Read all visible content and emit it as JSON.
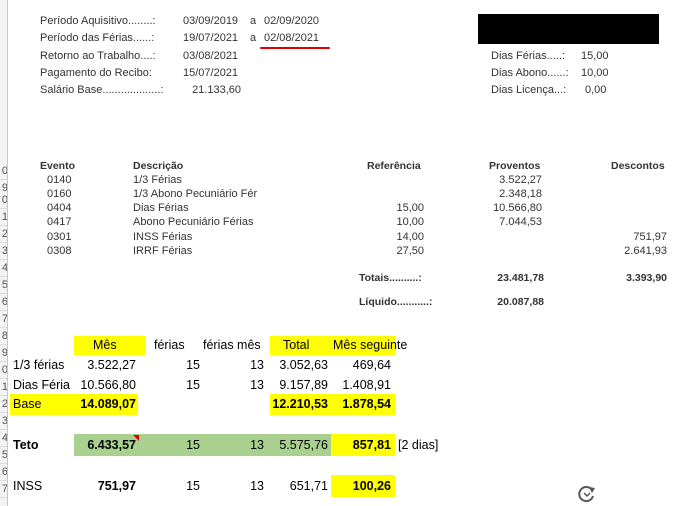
{
  "row_numbers": [
    "",
    "",
    "",
    "",
    "",
    "",
    "",
    "",
    "",
    "",
    "",
    "0",
    "1",
    "2",
    "3",
    "4",
    "5",
    "6",
    "7",
    "8",
    "9",
    "0",
    "1",
    "2",
    "3",
    "4",
    "5",
    "6",
    "7",
    "8",
    "9"
  ],
  "header": {
    "periodo_aquisitivo": {
      "label": "Período Aquisitivo........:",
      "from": "03/09/2019",
      "sep": "a",
      "to": "02/09/2020"
    },
    "periodo_ferias": {
      "label": "Período das Férias......:",
      "from": "19/07/2021",
      "sep": "a",
      "to": "02/08/2021"
    },
    "retorno": {
      "label": "Retorno ao Trabalho....:",
      "value": "03/08/2021"
    },
    "pagamento": {
      "label": "Pagamento do Recibo:",
      "value": "15/07/2021"
    },
    "salario": {
      "label": "Salário Base...................:",
      "value": "21.133,60"
    },
    "dias_ferias": {
      "label": "Dias Férias.....:",
      "value": "15,00"
    },
    "dias_abono": {
      "label": "Dias Abono......:",
      "value": "10,00"
    },
    "dias_licenca": {
      "label": "Dias Licença...:",
      "value": "0,00"
    }
  },
  "table": {
    "headers": {
      "evento": "Evento",
      "descricao": "Descrição",
      "referencia": "Referência",
      "proventos": "Proventos",
      "descontos": "Descontos"
    },
    "rows": [
      {
        "evento": "0140",
        "descricao": "1/3 Férias",
        "referencia": "",
        "proventos": "3.522,27",
        "descontos": ""
      },
      {
        "evento": "0160",
        "descricao": "1/3 Abono Pecuniário Fér",
        "referencia": "",
        "proventos": "2.348,18",
        "descontos": ""
      },
      {
        "evento": "0404",
        "descricao": "Dias Férias",
        "referencia": "15,00",
        "proventos": "10.566,80",
        "descontos": ""
      },
      {
        "evento": "0417",
        "descricao": "Abono Pecuniário Férias",
        "referencia": "10,00",
        "proventos": "7.044,53",
        "descontos": ""
      },
      {
        "evento": "0301",
        "descricao": "INSS Férias",
        "referencia": "14,00",
        "proventos": "",
        "descontos": "751,97"
      },
      {
        "evento": "0308",
        "descricao": "IRRF Férias",
        "referencia": "27,50",
        "proventos": "",
        "descontos": "2.641,93"
      }
    ],
    "totais": {
      "label": "Totais..........:",
      "proventos": "23.481,78",
      "descontos": "3.393,90"
    },
    "liquido": {
      "label": "Líquido...........:",
      "value": "20.087,88"
    }
  },
  "sheet": {
    "headers": {
      "mes": "Mês",
      "ferias": "férias",
      "ferias_mes": "férias mês",
      "total": "Total",
      "mes_seguinte": "Mês seguinte"
    },
    "row_terco": {
      "label": "1/3 férias",
      "mes": "3.522,27",
      "ferias": "15",
      "ferias_mes": "13",
      "total": "3.052,63",
      "mes_seguinte": "469,64"
    },
    "row_dias": {
      "label": "Dias Féria",
      "mes": "10.566,80",
      "ferias": "15",
      "ferias_mes": "13",
      "total": "9.157,89",
      "mes_seguinte": "1.408,91"
    },
    "row_base": {
      "label": "Base",
      "mes": "14.089,07",
      "total": "12.210,53",
      "mes_seguinte": "1.878,54"
    },
    "row_teto": {
      "label": "Teto",
      "mes": "6.433,57",
      "ferias": "15",
      "ferias_mes": "13",
      "total": "5.575,76",
      "mes_seguinte": "857,81",
      "note": "[2 dias]"
    },
    "row_inss": {
      "label": "INSS",
      "mes": "751,97",
      "ferias": "15",
      "ferias_mes": "13",
      "total": "651,71",
      "mes_seguinte": "100,26"
    }
  },
  "colors": {
    "highlight_yellow": "#ffff00",
    "highlight_green": "#a9d08e",
    "underline_red": "#e00000",
    "redaction": "#000000"
  },
  "icons": {
    "reload": "reload-icon"
  }
}
